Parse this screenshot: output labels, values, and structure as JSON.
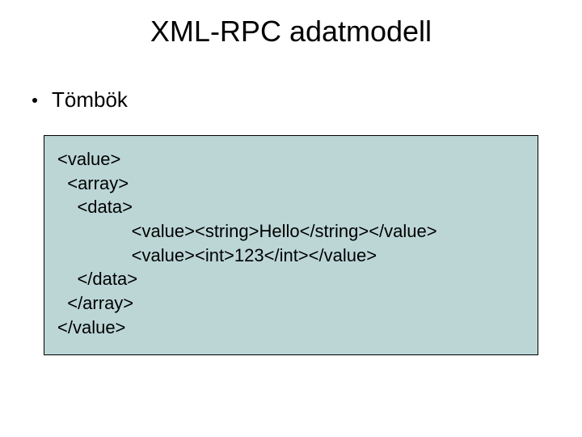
{
  "title": "XML-RPC adatmodell",
  "bullet": "Tömbök",
  "code": {
    "l1": "<value>",
    "l2": "  <array>",
    "l3": "    <data>",
    "l4": "               <value><string>Hello</string></value>",
    "l5": "               <value><int>123</int></value>",
    "l6": "    </data>",
    "l7": "  </array>",
    "l8": "</value>"
  }
}
